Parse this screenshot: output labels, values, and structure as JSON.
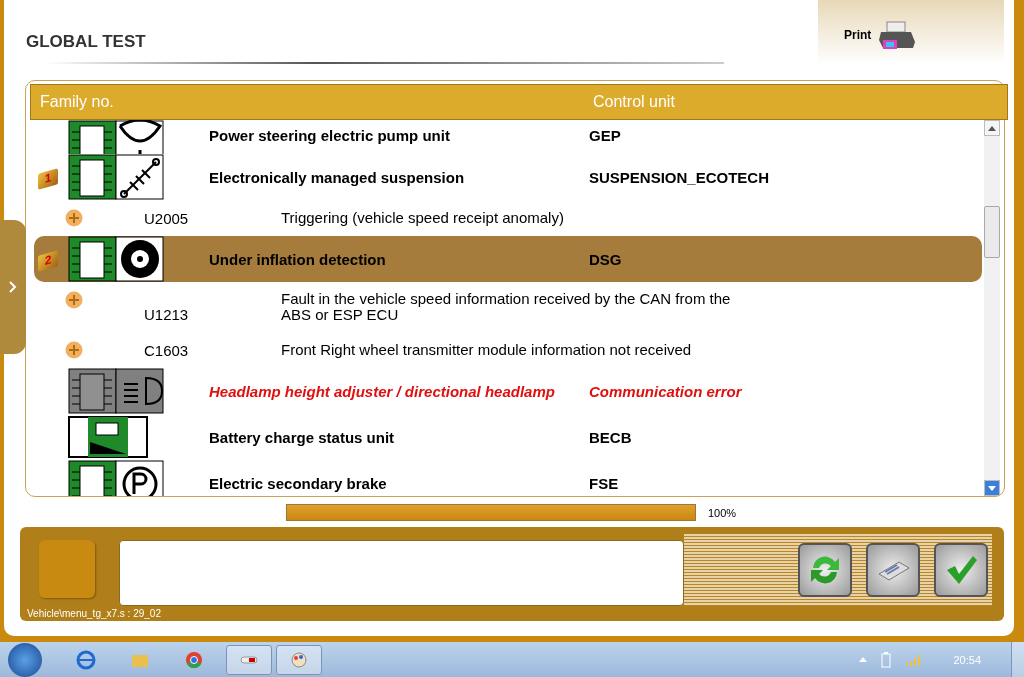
{
  "title": "GLOBAL TEST",
  "print": {
    "label": "Print"
  },
  "table": {
    "columns": [
      "Family no.",
      "Control unit"
    ],
    "rows": [
      {
        "kind": "unit",
        "name": "Power steering electric pump unit",
        "code": "GEP",
        "selected": false,
        "error": false
      },
      {
        "kind": "unit",
        "name": "Electronically managed suspension",
        "code": "SUSPENSION_ECOTECH",
        "selected": false,
        "error": false,
        "flag": "1"
      },
      {
        "kind": "fault",
        "code": "U2005",
        "description": "Triggering (vehicle speed receipt anomaly)",
        "selected": false
      },
      {
        "kind": "unit",
        "name": "Under inflation detection",
        "code": "DSG",
        "selected": true,
        "error": false,
        "flag": "2"
      },
      {
        "kind": "fault",
        "code": "U1213",
        "description": "Fault in the vehicle speed information received by the CAN from the ABS or ESP ECU",
        "selected": false
      },
      {
        "kind": "fault",
        "code": "C1603",
        "description": "Front Right wheel transmitter module information not received",
        "selected": false
      },
      {
        "kind": "unit",
        "name": "Headlamp height adjuster / directional headlamp",
        "code": "Communication error",
        "selected": false,
        "error": true
      },
      {
        "kind": "unit",
        "name": "Battery charge status unit",
        "code": "BECB",
        "selected": false,
        "error": false
      },
      {
        "kind": "unit",
        "name": "Electric secondary brake",
        "code": "FSE",
        "selected": false,
        "error": false
      }
    ]
  },
  "progress": {
    "level": 1.0,
    "reading": "100%"
  },
  "footer_path": "Vehicle\\menu_tg_x7.s : 29_02",
  "taskbar": {
    "clock": "20:54"
  }
}
